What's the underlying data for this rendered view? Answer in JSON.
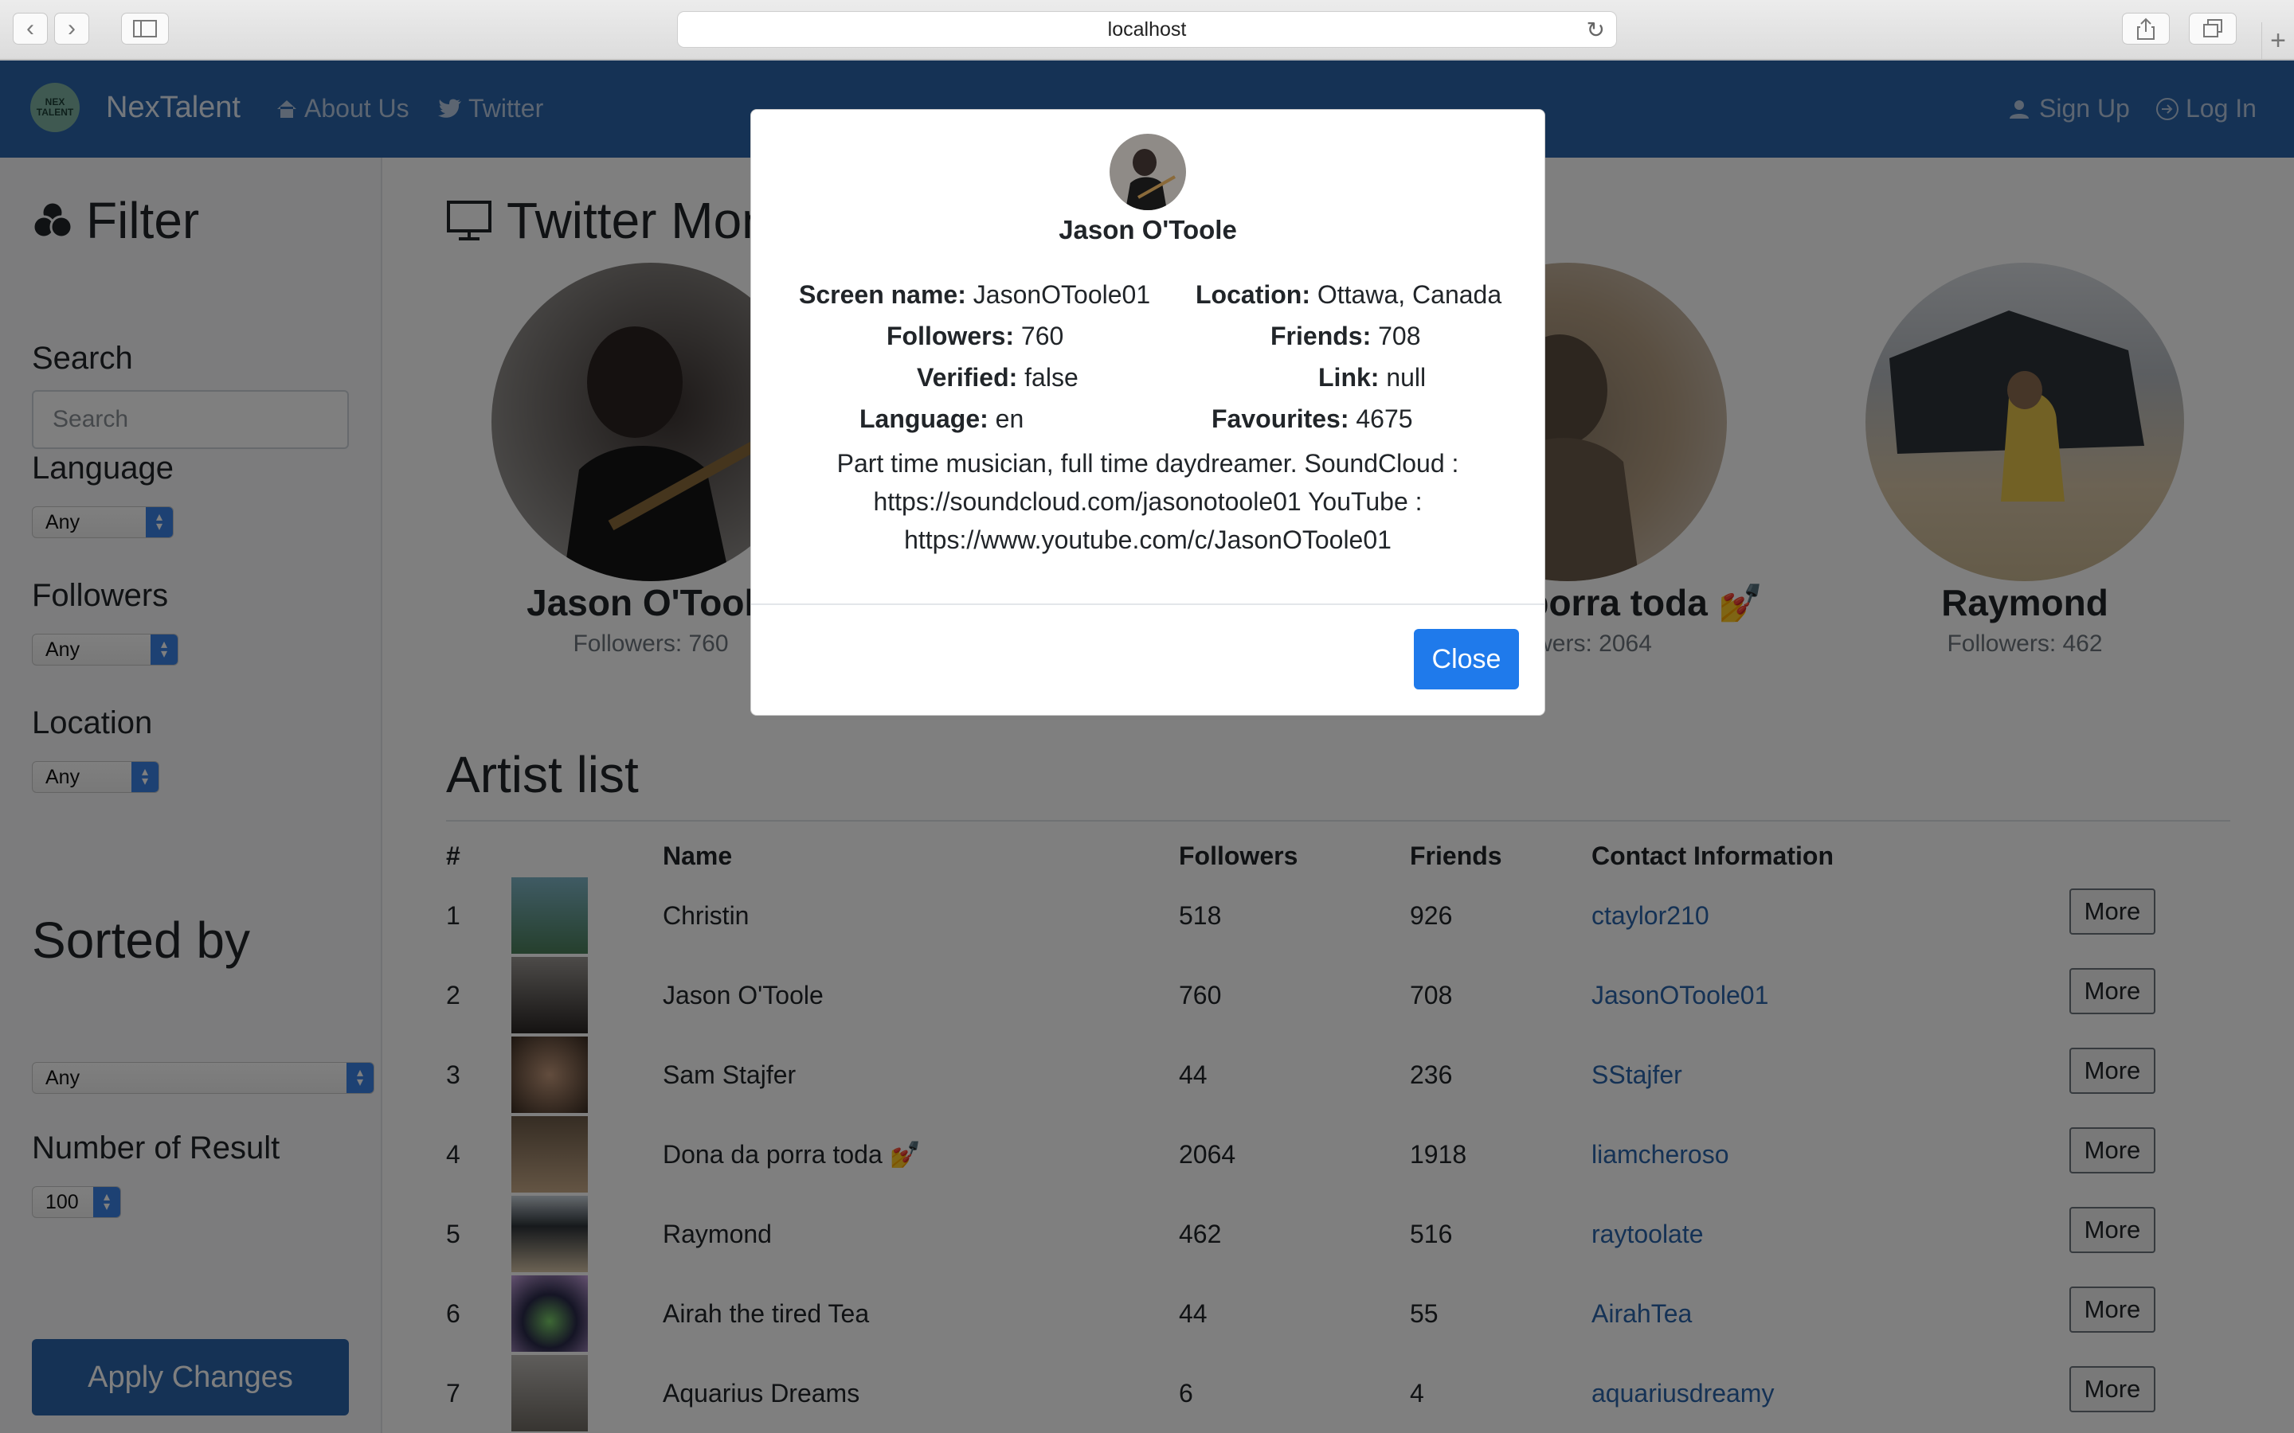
{
  "browser": {
    "url": "localhost"
  },
  "nav": {
    "brand": "NexTalent",
    "logo_text": "NEX TALENT",
    "about": "About Us",
    "twitter": "Twitter",
    "signup": "Sign Up",
    "login": "Log In"
  },
  "sidebar": {
    "title": "Filter",
    "search_label": "Search",
    "search_placeholder": "Search",
    "language_label": "Language",
    "language_value": "Any",
    "followers_label": "Followers",
    "followers_value": "Any",
    "location_label": "Location",
    "location_value": "Any",
    "sorted_label": "Sorted by",
    "sorted_value": "Any",
    "number_label": "Number of Result",
    "number_value": "100",
    "apply": "Apply Changes"
  },
  "main": {
    "title": "Twitter Monitor",
    "cards": [
      {
        "name": "Jason O'Toole",
        "followers": "Followers: 760"
      },
      {
        "name": "Dona da porra toda 💅",
        "followers": "Followers: 2064"
      },
      {
        "name": "Raymond",
        "followers": "Followers: 462"
      }
    ],
    "artist_list_title": "Artist list",
    "headers": [
      "#",
      "Name",
      "Followers",
      "Friends",
      "Contact Information"
    ],
    "more_label": "More",
    "rows": [
      {
        "num": "1",
        "name": "Christin",
        "followers": "518",
        "friends": "926",
        "contact": "ctaylor210"
      },
      {
        "num": "2",
        "name": "Jason O'Toole",
        "followers": "760",
        "friends": "708",
        "contact": "JasonOToole01"
      },
      {
        "num": "3",
        "name": "Sam Stajfer",
        "followers": "44",
        "friends": "236",
        "contact": "SStajfer"
      },
      {
        "num": "4",
        "name": "Dona da porra toda 💅",
        "followers": "2064",
        "friends": "1918",
        "contact": "liamcheroso"
      },
      {
        "num": "5",
        "name": "Raymond",
        "followers": "462",
        "friends": "516",
        "contact": "raytoolate"
      },
      {
        "num": "6",
        "name": "Airah the tired Tea",
        "followers": "44",
        "friends": "55",
        "contact": "AirahTea"
      },
      {
        "num": "7",
        "name": "Aquarius Dreams",
        "followers": "6",
        "friends": "4",
        "contact": "aquariusdreamy"
      }
    ]
  },
  "modal": {
    "name": "Jason O'Toole",
    "screen_name_label": "Screen name:",
    "screen_name": "JasonOToole01",
    "location_label": "Location:",
    "location": "Ottawa, Canada",
    "followers_label": "Followers:",
    "followers": "760",
    "friends_label": "Friends:",
    "friends": "708",
    "verified_label": "Verified:",
    "verified": "false",
    "link_label": "Link:",
    "link": "null",
    "language_label": "Language:",
    "language": "en",
    "favourites_label": "Favourites:",
    "favourites": "4675",
    "description": "Part time musician, full time daydreamer. SoundCloud : https://soundcloud.com/jasonotoole01 YouTube : https://www.youtube.com/c/JasonOToole01",
    "close": "Close"
  }
}
